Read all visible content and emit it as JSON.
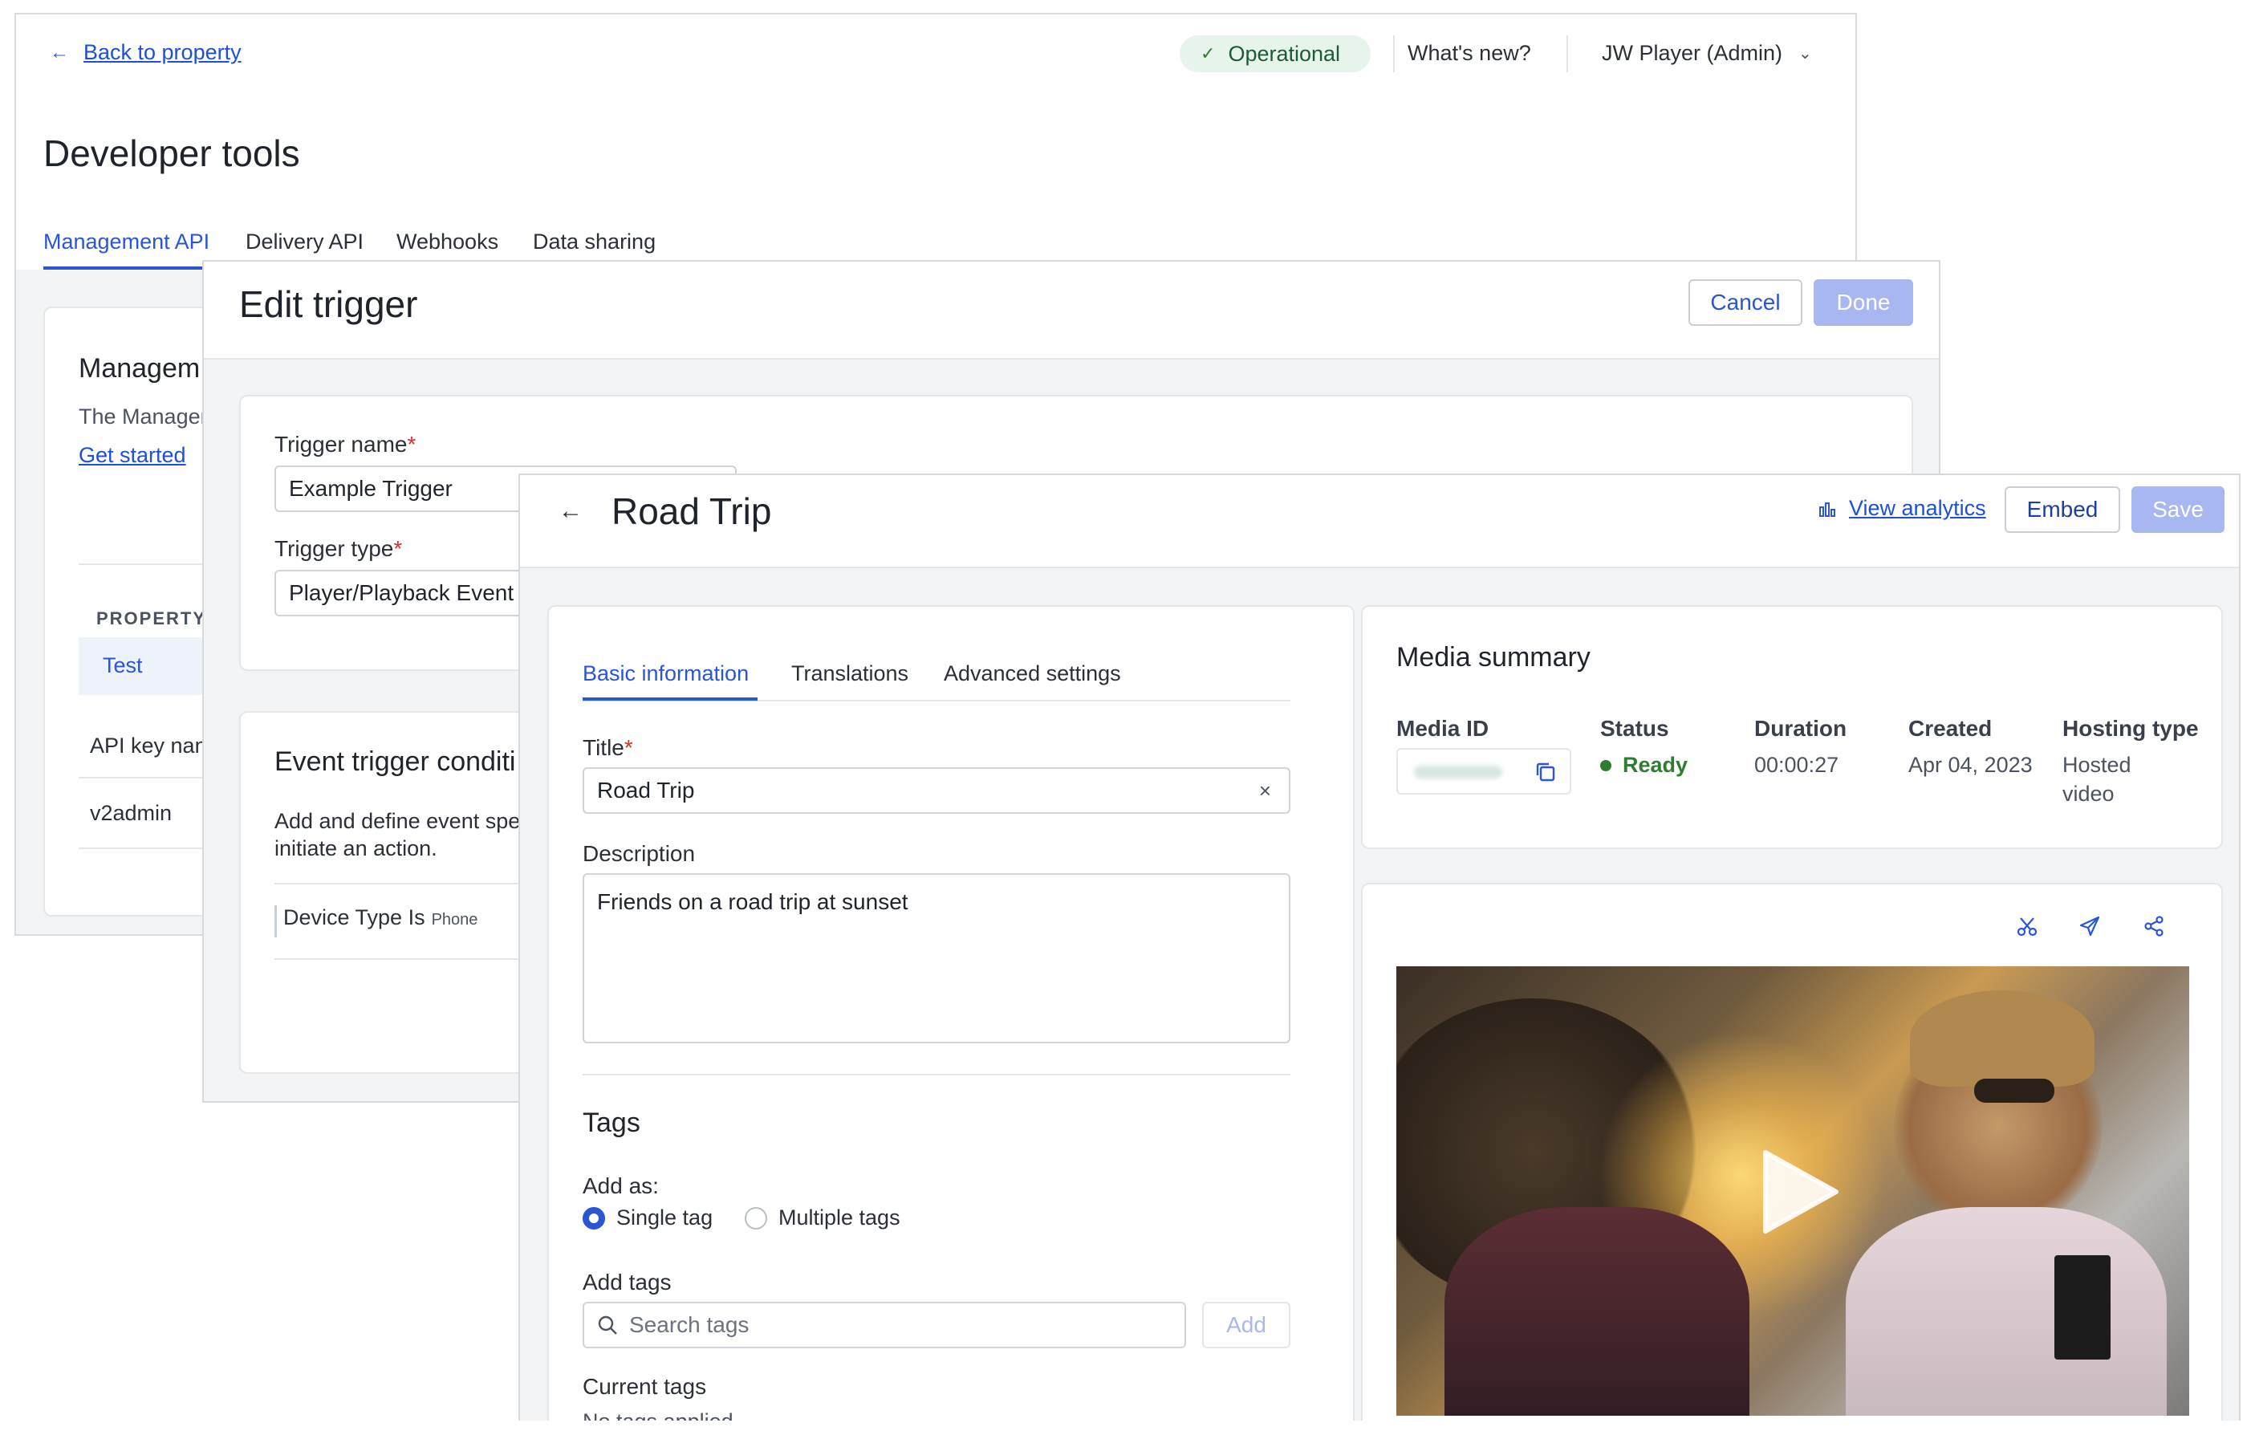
{
  "dev": {
    "back_link": "Back to property",
    "status": "Operational",
    "whats_new": "What's new?",
    "account": "JW Player (Admin)",
    "title": "Developer tools",
    "tabs": [
      "Management API",
      "Delivery API",
      "Webhooks",
      "Data sharing"
    ],
    "card_title": "Managem",
    "card_desc": "The Manager",
    "get_started": "Get started",
    "property_header": "PROPERTY",
    "property_value": "Test",
    "api_key_label": "API key nan",
    "api_key_value": "v2admin"
  },
  "trigger": {
    "title": "Edit trigger",
    "cancel": "Cancel",
    "done": "Done",
    "name_label": "Trigger name",
    "name_value": "Example Trigger",
    "type_label": "Trigger type",
    "type_value": "Player/Playback Event",
    "conditions_title": "Event trigger conditi",
    "conditions_desc1": "Add and define event spec",
    "conditions_desc2": "initiate an action.",
    "condition_main": "Device Type Is",
    "condition_value": "Phone",
    "required_mark": "*"
  },
  "media": {
    "title": "Road Trip",
    "view_analytics": "View analytics",
    "embed": "Embed",
    "save": "Save",
    "tabs": [
      "Basic information",
      "Translations",
      "Advanced settings"
    ],
    "title_label": "Title",
    "title_value": "Road Trip",
    "description_label": "Description",
    "description_value": "Friends on a road trip at sunset",
    "tags_heading": "Tags",
    "add_as": "Add as:",
    "single_tag": "Single tag",
    "multiple_tags": "Multiple tags",
    "add_tags": "Add tags",
    "search_placeholder": "Search tags",
    "add_button": "Add",
    "current_tags": "Current tags",
    "no_tags": "No tags applied",
    "summary_title": "Media summary",
    "media_id_label": "Media ID",
    "status_label": "Status",
    "status_value": "Ready",
    "duration_label": "Duration",
    "duration_value": "00:00:27",
    "created_label": "Created",
    "created_value": "Apr 04, 2023",
    "hosting_label": "Hosting type",
    "hosting_value_1": "Hosted",
    "hosting_value_2": "video"
  },
  "colors": {
    "accent": "#2a55d4",
    "disabled_button": "#a8b7f0",
    "ready": "#2e7d32",
    "operational_bg": "#e7f4ec"
  }
}
